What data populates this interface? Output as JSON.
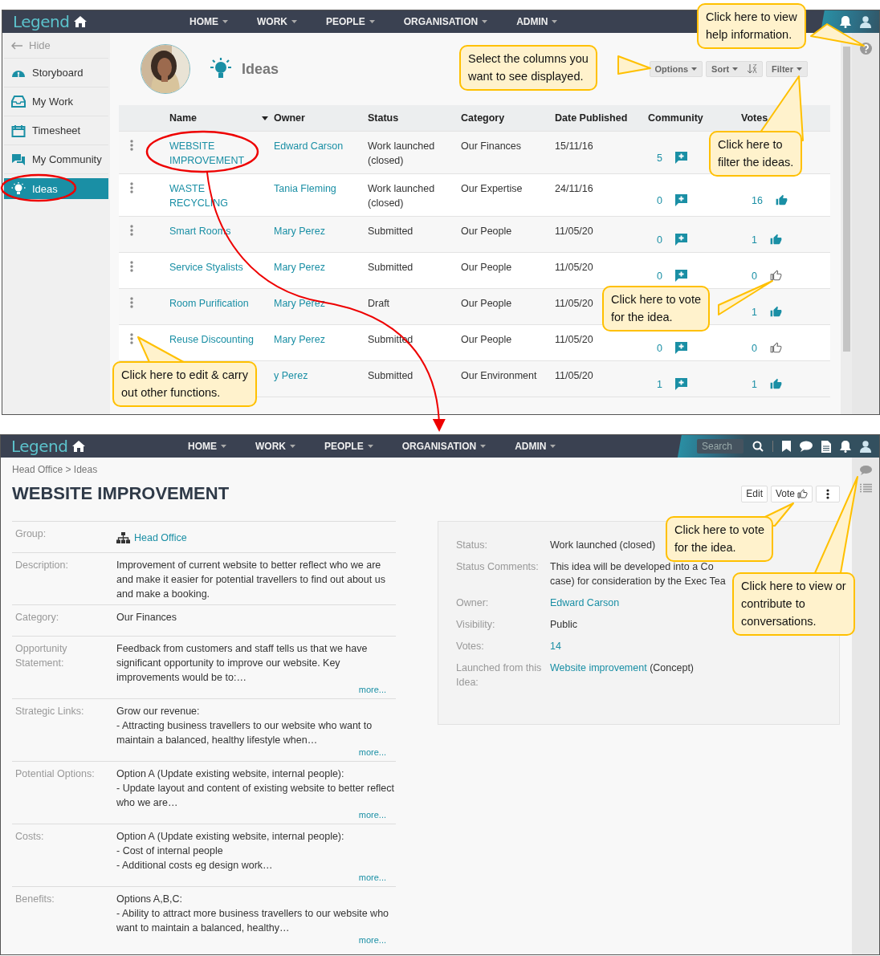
{
  "top_screen": {
    "brand": "Legend",
    "nav": [
      "HOME",
      "WORK",
      "PEOPLE",
      "ORGANISATION",
      "ADMIN"
    ],
    "sidebar": {
      "hide_label": "Hide",
      "items": [
        {
          "label": "Storyboard",
          "selected": false
        },
        {
          "label": "My Work",
          "selected": false
        },
        {
          "label": "Timesheet",
          "selected": false
        },
        {
          "label": "My Community",
          "selected": false
        },
        {
          "label": "Ideas",
          "selected": true
        }
      ]
    },
    "page_title": "Ideas",
    "toolbar": [
      "Options",
      "Sort",
      "Filter"
    ],
    "table": {
      "columns": [
        "Name",
        "Owner",
        "Status",
        "Category",
        "Date Published",
        "Community",
        "Votes"
      ],
      "rows": [
        {
          "name": "WEBSITE IMPROVEMENT",
          "owner": "Edward Carson",
          "status": "Work launched (closed)",
          "category": "Our Finances",
          "date": "15/11/16",
          "community": "5"
        },
        {
          "name": "WASTE RECYCLING",
          "owner": "Tania Fleming",
          "status": "Work launched (closed)",
          "category": "Our Expertise",
          "date": "24/11/16",
          "community": "0",
          "votes": "16",
          "voted": true
        },
        {
          "name": "Smart Rooms",
          "owner": "Mary Perez",
          "status": "Submitted",
          "category": "Our People",
          "date": "11/05/20",
          "community": "0",
          "votes": "1",
          "voted": true
        },
        {
          "name": "Service Styalists",
          "owner": "Mary Perez",
          "status": "Submitted",
          "category": "Our People",
          "date": "11/05/20",
          "community": "0",
          "votes": "0",
          "voted": false
        },
        {
          "name": "Room Purification",
          "owner": "Mary Perez",
          "status": "Draft",
          "category": "Our People",
          "date": "11/05/20",
          "votes": "1",
          "voted": true
        },
        {
          "name": "Reuse Discounting",
          "owner": "Mary Perez",
          "status": "Submitted",
          "category": "Our People",
          "date": "11/05/20",
          "community": "0",
          "votes": "0",
          "voted": false
        },
        {
          "owner": "y Perez",
          "status": "Submitted",
          "category": "Our Environment",
          "date": "11/05/20",
          "community": "1",
          "votes": "1",
          "voted": true
        }
      ]
    }
  },
  "bottom_screen": {
    "brand": "Legend",
    "nav": [
      "HOME",
      "WORK",
      "PEOPLE",
      "ORGANISATION",
      "ADMIN"
    ],
    "search": {
      "placeholder": "Search"
    },
    "breadcrumb": "Head Office > Ideas",
    "title": "WEBSITE IMPROVEMENT",
    "actions": [
      "Edit",
      "Vote"
    ],
    "details": [
      {
        "kind": "group",
        "label": "Group:",
        "value": "Head Office"
      },
      {
        "kind": "text",
        "label": "Description:",
        "value": "Improvement of current website to better reflect who we are and make it easier for potential travellers to find out about us and make a booking."
      },
      {
        "kind": "text",
        "label": "Category:",
        "value": "Our Finances"
      },
      {
        "kind": "text",
        "label": "Opportunity Statement:",
        "value": "Feedback from customers and staff tells us that we have significant opportunity to improve our website.  Key improvements would be to:…",
        "more": "more..."
      },
      {
        "kind": "text",
        "label": "Strategic Links:",
        "value": "Grow our revenue:\n- Attracting business travellers to our website who want to maintain a balanced, healthy lifestyle when…",
        "more": "more..."
      },
      {
        "kind": "text",
        "label": "Potential Options:",
        "value": "Option A (Update existing website, internal people):\n- Update layout and content of existing website to better reflect who we are…",
        "more": "more..."
      },
      {
        "kind": "text",
        "label": "Costs:",
        "value": "Option A (Update existing website, internal people):\n- Cost of internal people\n- Additional costs eg design work…",
        "more": "more..."
      },
      {
        "kind": "text",
        "label": "Benefits:",
        "value": "Options A,B,C:\n- Ability to attract more business travellers to our website who want to maintain a balanced, healthy…",
        "more": "more..."
      }
    ],
    "summary": [
      {
        "kind": "text",
        "label": "Status:",
        "value": "Work launched (closed)"
      },
      {
        "kind": "text",
        "label": "Status Comments:",
        "value": "This idea will be developed into a Co\ncase) for consideration by the Exec Tea"
      },
      {
        "kind": "link",
        "label": "Owner:",
        "value": "Edward Carson"
      },
      {
        "kind": "text",
        "label": "Visibility:",
        "value": "Public"
      },
      {
        "kind": "link",
        "label": "Votes:",
        "value": "14"
      },
      {
        "kind": "link_note",
        "label": "Launched from this Idea:",
        "value": "Website improvement",
        "note": "(Concept)"
      }
    ]
  },
  "callouts": [
    {
      "text": "Click here to view\nhelp information."
    },
    {
      "text": "Select the columns you\nwant to see displayed."
    },
    {
      "text": "Click here to\nfilter the ideas."
    },
    {
      "text": "Click here to vote\nfor the idea."
    },
    {
      "text": "Click here to edit & carry\nout other functions."
    },
    {
      "text": "Click here to vote\nfor the idea."
    },
    {
      "text": "Click here to view or\ncontribute to\nconversations."
    }
  ]
}
